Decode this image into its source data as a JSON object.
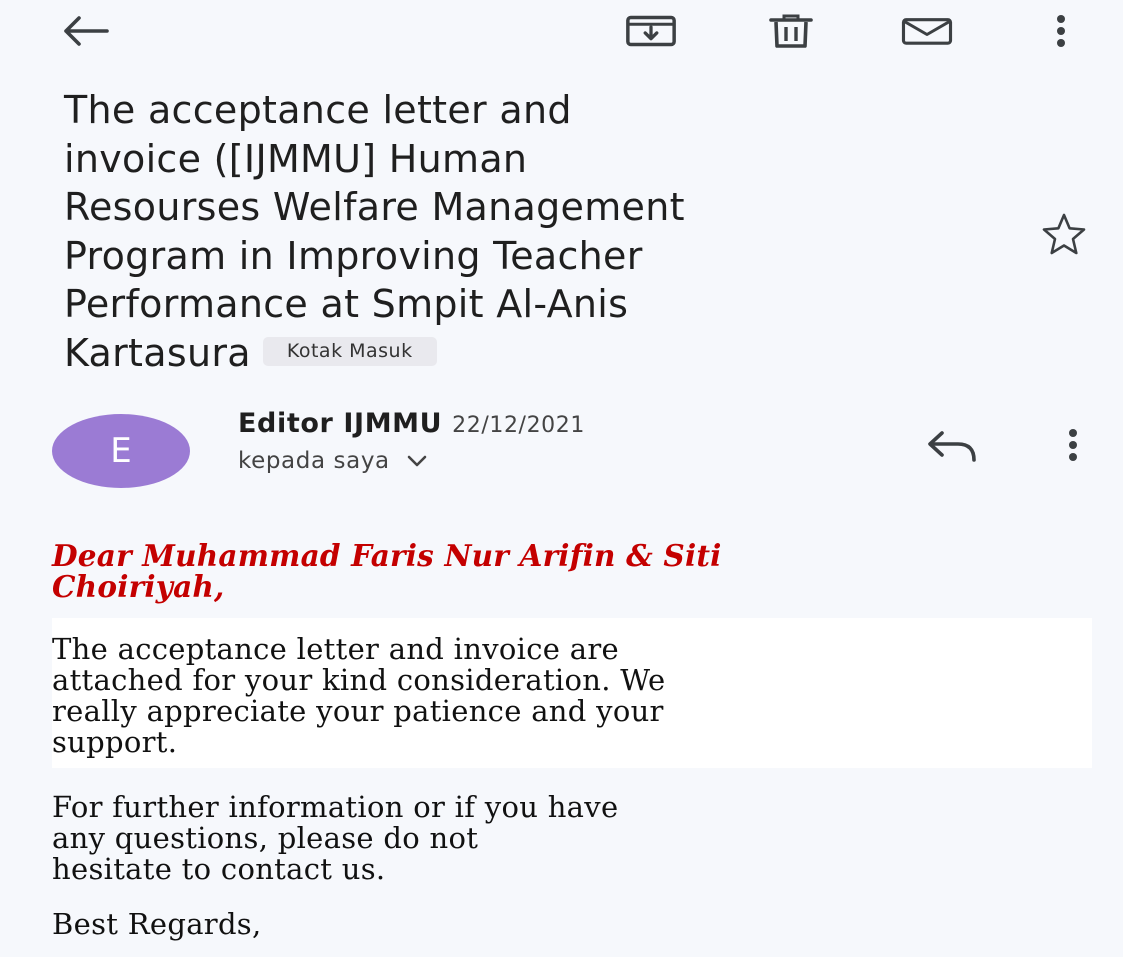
{
  "toolbar": {
    "icons": [
      "back-arrow-icon",
      "archive-icon",
      "trash-icon",
      "mail-unread-icon",
      "more-vert-icon"
    ]
  },
  "email": {
    "subject_lines": [
      "The acceptance letter and",
      "invoice ([IJMMU] Human",
      "Resourses Welfare Management",
      "Program in Improving Teacher",
      "Performance at Smpit Al-Anis",
      "Kartasura"
    ],
    "label": "Kotak Masuk",
    "sender": {
      "initial": "E",
      "name": "Editor IJMMU",
      "date": "22/12/2021",
      "recipient": "kepada saya",
      "avatar_color": "#9b7bd4"
    },
    "body": {
      "greeting_lines": [
        "Dear Muhammad Faris Nur Arifin & Siti",
        "Choiriyah,"
      ],
      "paragraph1_lines": [
        "The acceptance letter and invoice are",
        "attached for your kind consideration. We",
        "really appreciate your patience and your",
        "support."
      ],
      "paragraph2_lines": [
        "For further information or if you have",
        "any questions, please do not",
        "hesitate to contact us."
      ],
      "signoff": "Best Regards,"
    }
  },
  "colors": {
    "background": "#f6f8fc",
    "greeting": "#c40000",
    "label_chip": "#e9e9ee"
  }
}
